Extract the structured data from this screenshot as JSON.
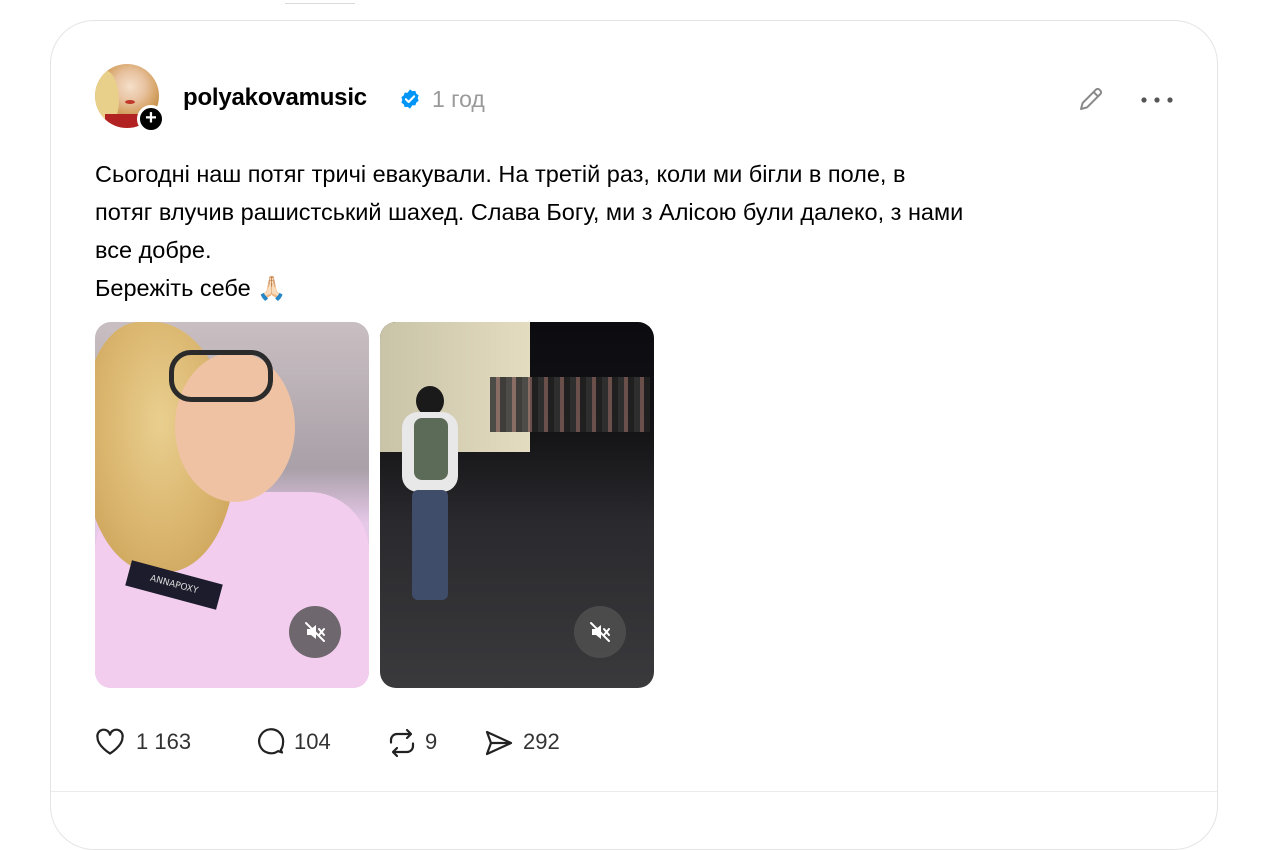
{
  "post": {
    "username": "polyakovamusic",
    "verified": true,
    "time": "1 год",
    "text_lines": [
      "Сьогодні наш потяг тричі евакували. На третій раз, коли ми бігли в поле, в",
      "потяг влучив рашистський шахед. Слава Богу, ми з Алісою були далеко, з нами",
      "все добре.",
      "Бережіть себе 🙏🏻"
    ],
    "media": [
      {
        "type": "video",
        "muted": true,
        "label_on_shirt": "ANNAPOXY"
      },
      {
        "type": "video",
        "muted": true
      }
    ],
    "stats": {
      "likes": "1 163",
      "comments": "104",
      "reposts": "9",
      "shares": "292"
    }
  },
  "icons": {
    "verified": "verified-badge-icon",
    "edit": "pencil-icon",
    "more": "more-dots-icon",
    "like": "heart-icon",
    "comment": "comment-bubble-icon",
    "repost": "repost-icon",
    "share": "send-icon",
    "mute": "speaker-muted-icon"
  },
  "colors": {
    "verified": "#0095f6",
    "muted_text": "#9a9a9a"
  }
}
